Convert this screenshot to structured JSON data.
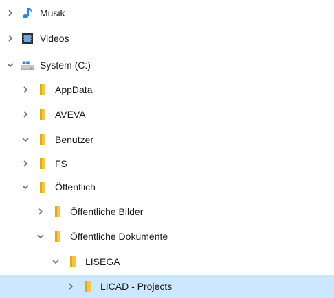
{
  "tree": {
    "items": [
      {
        "label": "Musik",
        "icon": "music-note-icon",
        "expanded": false,
        "level": 0,
        "selected": false
      },
      {
        "label": "Videos",
        "icon": "film-icon",
        "expanded": false,
        "level": 0,
        "selected": false
      },
      {
        "label": "System (C:)",
        "icon": "drive-icon",
        "expanded": true,
        "level": 0,
        "selected": false
      },
      {
        "label": "AppData",
        "icon": "folder-icon",
        "expanded": false,
        "level": 1,
        "selected": false
      },
      {
        "label": "AVEVA",
        "icon": "folder-icon",
        "expanded": false,
        "level": 1,
        "selected": false
      },
      {
        "label": "Benutzer",
        "icon": "folder-icon",
        "expanded": true,
        "level": 1,
        "selected": false
      },
      {
        "label": "FS",
        "icon": "folder-icon",
        "expanded": false,
        "level": 1,
        "selected": false
      },
      {
        "label": "Öffentlich",
        "icon": "folder-icon",
        "expanded": true,
        "level": 1,
        "selected": false
      },
      {
        "label": "Öffentliche Bilder",
        "icon": "folder-icon",
        "expanded": false,
        "level": 2,
        "selected": false
      },
      {
        "label": "Öffentliche Dokumente",
        "icon": "folder-icon",
        "expanded": true,
        "level": 2,
        "selected": false
      },
      {
        "label": "LISEGA",
        "icon": "folder-icon",
        "expanded": true,
        "level": 3,
        "selected": false
      },
      {
        "label": "LICAD - Projects",
        "icon": "folder-icon",
        "expanded": false,
        "level": 4,
        "selected": true
      }
    ]
  },
  "colors": {
    "selection": "#cce8ff",
    "folder": "#f2c744",
    "music": "#1e88e5",
    "chevron": "#6b6b6b"
  }
}
